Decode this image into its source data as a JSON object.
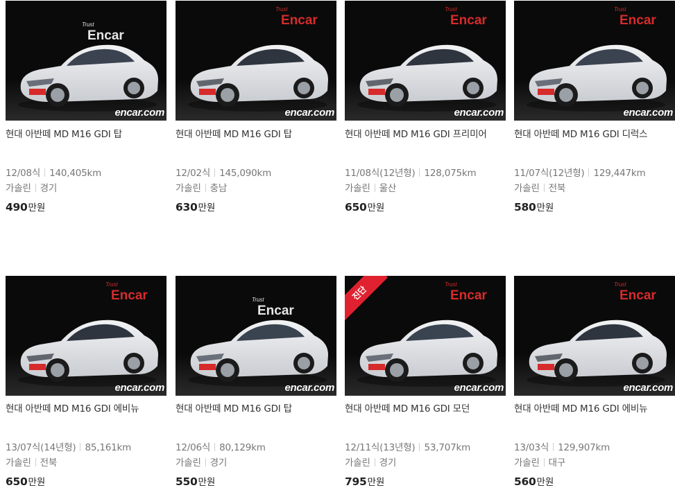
{
  "price_unit": "만원",
  "brand_logo": {
    "text": "Encar",
    "tagline": "Trust",
    "watermark": "encar.com"
  },
  "listings": [
    {
      "title": "현대 아반떼 MD M16 GDI 탑",
      "year": "12/08식",
      "mileage": "140,405km",
      "fuel": "가솔린",
      "region": "경기",
      "price": "490",
      "car_color": "white",
      "bg": "dark"
    },
    {
      "title": "현대 아반떼 MD M16 GDI 탑",
      "year": "12/02식",
      "mileage": "145,090km",
      "fuel": "가솔린",
      "region": "충남",
      "price": "630",
      "car_color": "silver",
      "bg": "light"
    },
    {
      "title": "현대 아반떼 MD M16 GDI 프리미어",
      "year": "11/08식(12년형)",
      "mileage": "128,075km",
      "fuel": "가솔린",
      "region": "울산",
      "price": "650",
      "car_color": "silver",
      "bg": "light"
    },
    {
      "title": "현대 아반떼 MD M16 GDI 디럭스",
      "year": "11/07식(12년형)",
      "mileage": "129,447km",
      "fuel": "가솔린",
      "region": "전북",
      "price": "580",
      "car_color": "white",
      "bg": "light"
    },
    {
      "title": "현대 아반떼 MD M16 GDI 에비뉴",
      "year": "13/07식(14년형)",
      "mileage": "85,161km",
      "fuel": "가솔린",
      "region": "전북",
      "price": "650",
      "car_color": "silver",
      "bg": "light"
    },
    {
      "title": "현대 아반떼 MD M16 GDI 탑",
      "year": "12/06식",
      "mileage": "80,129km",
      "fuel": "가솔린",
      "region": "경기",
      "price": "550",
      "car_color": "black",
      "bg": "dark"
    },
    {
      "title": "현대 아반떼 MD M16 GDI 모던",
      "year": "12/11식(13년형)",
      "mileage": "53,707km",
      "fuel": "가솔린",
      "region": "경기",
      "price": "795",
      "car_color": "black",
      "bg": "light",
      "badge": "진단"
    },
    {
      "title": "현대 아반떼 MD M16 GDI 에비뉴",
      "year": "13/03식",
      "mileage": "129,907km",
      "fuel": "가솔린",
      "region": "대구",
      "price": "560",
      "car_color": "silver",
      "bg": "light"
    }
  ],
  "colors": {
    "accent_red": "#d72b2b",
    "price_text": "#222222",
    "meta_text": "#777777"
  }
}
